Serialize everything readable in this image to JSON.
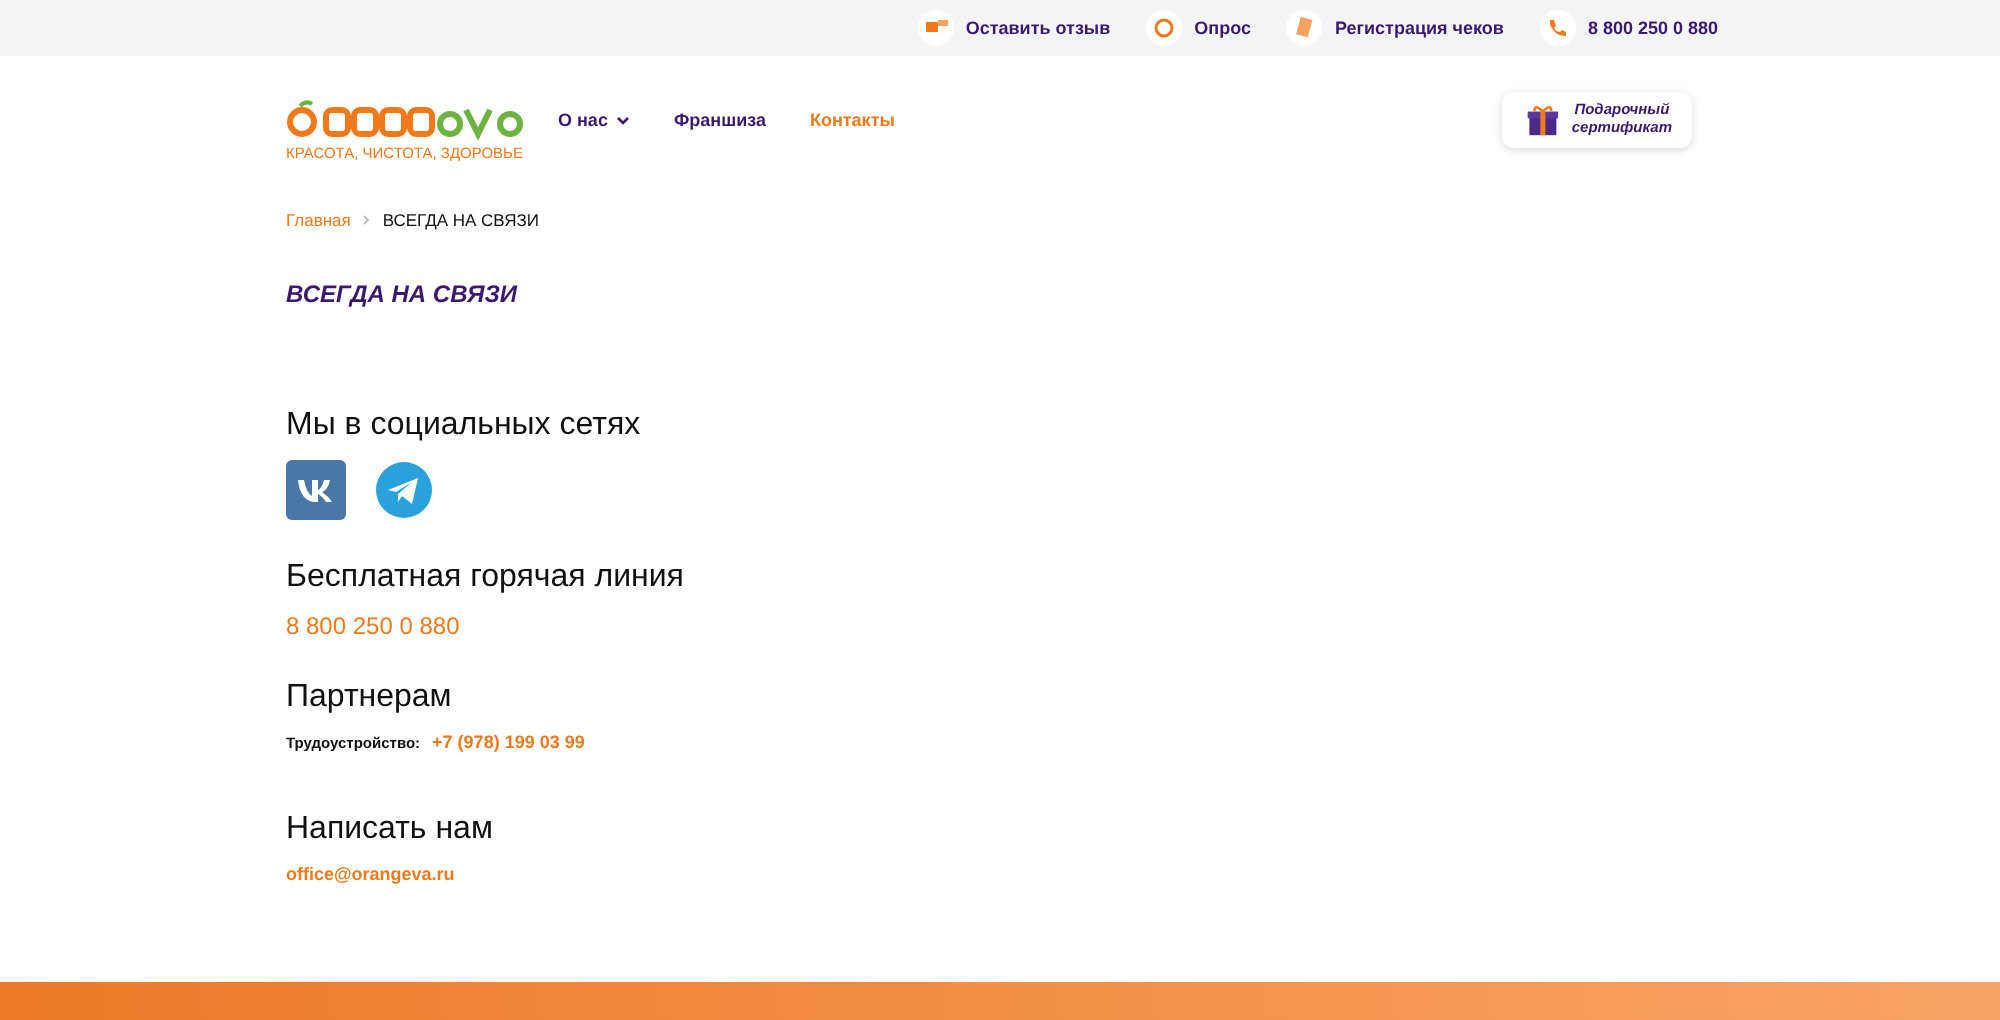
{
  "top_bar": [
    {
      "kind": "review",
      "label": "Оставить отзыв"
    },
    {
      "kind": "poll",
      "label": "Опрос"
    },
    {
      "kind": "receipt",
      "label": "Регистрация чеков"
    },
    {
      "kind": "phone",
      "label": "8 800 250 0 880"
    }
  ],
  "logo": {
    "tagline": "КРАСОТА, ЧИСТОТА, ЗДОРОВЬЕ"
  },
  "nav": [
    {
      "label": "О нас",
      "dropdown": true,
      "selected": false
    },
    {
      "label": "Франшиза",
      "dropdown": false,
      "selected": false
    },
    {
      "label": "Контакты",
      "dropdown": false,
      "selected": true
    }
  ],
  "gift_button": {
    "label": "Подарочный сертификат"
  },
  "breadcrumbs": [
    {
      "label": "Главная",
      "link": true
    },
    {
      "label": "ВСЕГДА НА СВЯЗИ",
      "link": false
    }
  ],
  "page_title": "ВСЕГДА НА СВЯЗИ",
  "sections": [
    {
      "kind": "social",
      "title": "Мы в социальных сетях",
      "networks": [
        {
          "kind": "vk"
        },
        {
          "kind": "telegram"
        }
      ]
    },
    {
      "kind": "hotline",
      "title": "Бесплатная горячая линия",
      "value": "8 800 250 0 880"
    },
    {
      "kind": "partners",
      "title": "Партнерам",
      "label": "Трудоустройство:",
      "value": "+7 (978) 199 03 99"
    },
    {
      "kind": "email",
      "title": "Написать нам",
      "value": "office@orangeva.ru"
    }
  ]
}
